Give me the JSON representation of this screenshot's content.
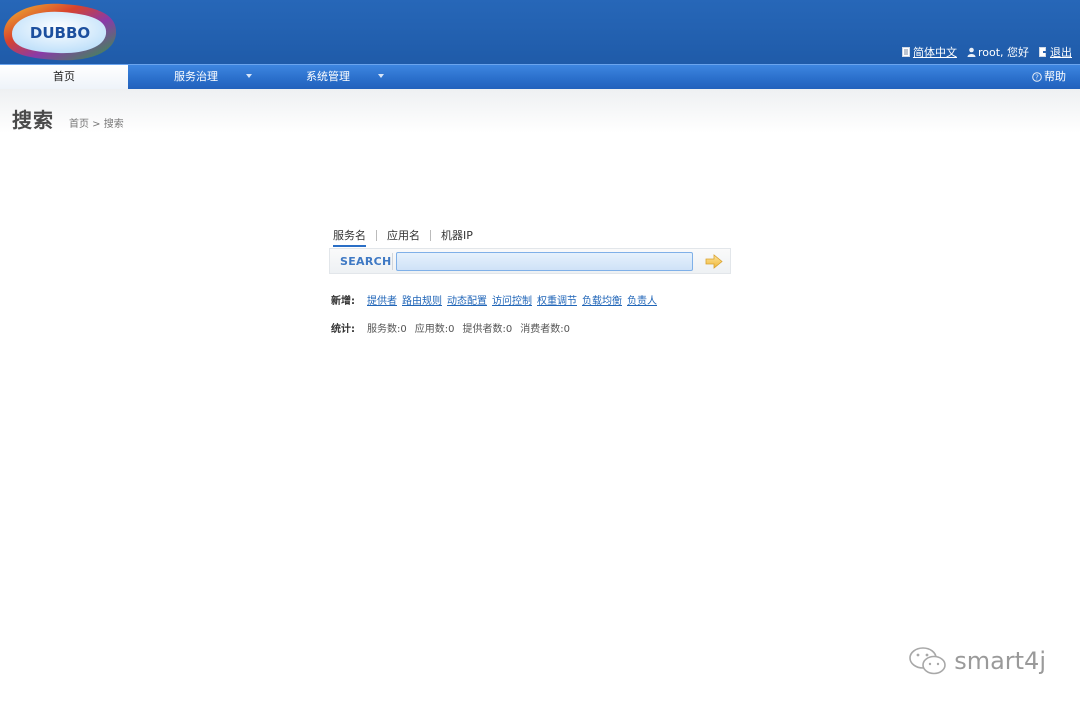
{
  "logo": {
    "text": "DUBBO"
  },
  "top_links": {
    "language": "简体中文",
    "user": "root, 您好",
    "logout": "退出"
  },
  "nav": {
    "home": "首页",
    "service_governance": "服务治理",
    "system_management": "系统管理",
    "help": "帮助"
  },
  "page": {
    "title": "搜索",
    "breadcrumb": "首页 > 搜索"
  },
  "search": {
    "tabs": [
      "服务名",
      "应用名",
      "机器IP"
    ],
    "active_tab": 0,
    "label": "SEARCH",
    "value": "",
    "placeholder": ""
  },
  "add_new": {
    "label": "新增:",
    "links": [
      "提供者",
      "路由规则",
      "动态配置",
      "访问控制",
      "权重调节",
      "负载均衡",
      "负责人"
    ]
  },
  "stats": {
    "label": "统计:",
    "items": [
      "服务数:0",
      "应用数:0",
      "提供者数:0",
      "消费者数:0"
    ]
  },
  "watermark": {
    "text": "smart4j"
  },
  "colors": {
    "header": "#2767b8",
    "nav": "#2b70cc",
    "link": "#2166b8",
    "search_label": "#3f79c4"
  }
}
